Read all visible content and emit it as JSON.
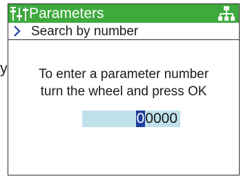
{
  "header": {
    "title": "Parameters",
    "left_icon": "parameters-icon",
    "right_icon": "network-icon"
  },
  "menu": {
    "chevron_icon": "chevron-right-icon",
    "label": "Search by number"
  },
  "instruction": {
    "line1": "To enter a parameter number",
    "line2": "turn the wheel and press OK"
  },
  "number_input": {
    "active_digit": "0",
    "remaining_digits": "0000"
  },
  "stray_text": "y",
  "colors": {
    "title_bar": "#3eaa3e",
    "input_bg": "#bfe1ea",
    "cursor_bg": "#1f3f9b",
    "chevron": "#1f3f9b"
  }
}
